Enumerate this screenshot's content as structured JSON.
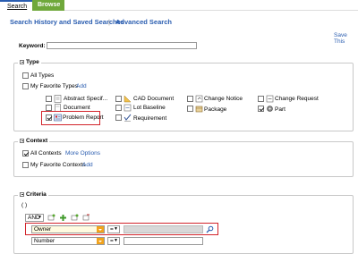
{
  "tabs": {
    "search": "Search",
    "browse": "Browse"
  },
  "subnav": {
    "history": "Search History and Saved Searches",
    "separator": "|",
    "advanced": "Advanced Search"
  },
  "save_link": "Save This",
  "keyword": {
    "label": "Keyword:",
    "value": ""
  },
  "type_section": {
    "title": "Type",
    "all_types": "All Types",
    "favorite_types": "My Favorite Types",
    "add": "Add",
    "items": [
      {
        "label": "Abstract Specif...",
        "checked": false
      },
      {
        "label": "Document",
        "checked": false
      },
      {
        "label": "Problem Report",
        "checked": true
      },
      {
        "label": "CAD Document",
        "checked": false
      },
      {
        "label": "Lot Baseline",
        "checked": false
      },
      {
        "label": "Requirement",
        "checked": false
      },
      {
        "label": "Change Notice",
        "checked": false
      },
      {
        "label": "Package",
        "checked": false
      },
      {
        "label": "Change Request",
        "checked": false
      },
      {
        "label": "Part",
        "checked": true
      }
    ]
  },
  "context_section": {
    "title": "Context",
    "all_contexts": "All Contexts",
    "more_options": "More Options",
    "favorite_contexts": "My Favorite Contexts",
    "add": "Add"
  },
  "criteria_section": {
    "title": "Criteria",
    "paren": "( )",
    "operator": "AND",
    "rows": [
      {
        "attribute": "Owner",
        "comparator": "=",
        "value": ""
      },
      {
        "attribute": "Number",
        "comparator": "=",
        "value": ""
      }
    ]
  },
  "colors": {
    "accent": "#2a5db0",
    "tab_green": "#6fa83b",
    "highlight": "#d2232a",
    "dropdown": "#f2a31c"
  }
}
